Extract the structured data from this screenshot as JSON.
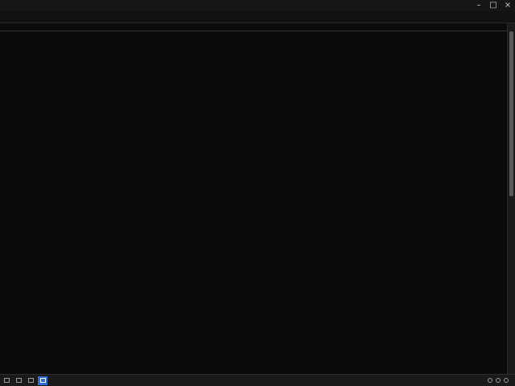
{
  "window": {
    "title": ""
  },
  "menu": [
    {
      "label": ""
    },
    {
      "label": ""
    },
    {
      "label": ""
    },
    {
      "label": ""
    },
    {
      "label": ""
    },
    {
      "label": ""
    },
    {
      "label": ""
    },
    {
      "label": ""
    },
    {
      "label": ""
    },
    {
      "label": ""
    },
    {
      "label": ""
    }
  ],
  "table": {
    "columns": [
      "",
      "",
      "",
      "",
      "",
      "",
      "",
      "",
      "",
      "",
      ""
    ],
    "rows": []
  },
  "taskbar": {
    "apps": [
      {
        "icon": "app-icon",
        "active": false
      },
      {
        "icon": "app-icon",
        "active": false
      },
      {
        "icon": "app-icon",
        "active": false
      },
      {
        "icon": "terminal-icon",
        "active": true
      }
    ],
    "tray": [
      "network-icon",
      "volume-icon",
      "battery-icon"
    ],
    "clock": ""
  },
  "colors": {
    "background": "#0b0b0b",
    "green_text": "#5fc76a",
    "blue_divider": "#3050b0",
    "red_divider": "#b03030",
    "taskbar_active": "#2d6fd6"
  }
}
